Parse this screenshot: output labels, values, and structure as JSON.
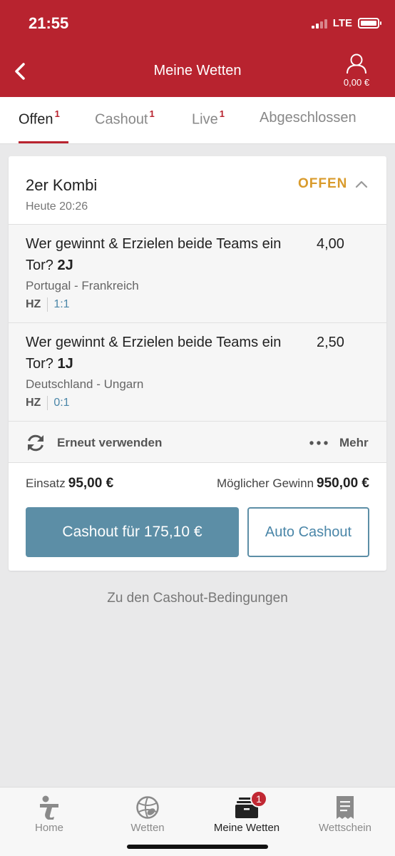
{
  "status_bar": {
    "time": "21:55",
    "network": "LTE"
  },
  "header": {
    "title": "Meine Wetten",
    "balance": "0,00 €"
  },
  "tabs": [
    {
      "label": "Offen",
      "count": "1",
      "active": true
    },
    {
      "label": "Cashout",
      "count": "1"
    },
    {
      "label": "Live",
      "count": "1"
    },
    {
      "label": "Abgeschlossen",
      "count": ""
    }
  ],
  "bet": {
    "type": "2er Kombi",
    "date": "Heute 20:26",
    "status": "OFFEN",
    "selections": [
      {
        "market": "Wer gewinnt & Erzielen beide Teams ein Tor?",
        "pick": "2J",
        "odds": "4,00",
        "event": "Portugal - Frankreich",
        "score_label": "HZ",
        "score": "1:1"
      },
      {
        "market": "Wer gewinnt & Erzielen beide Teams ein Tor?",
        "pick": "1J",
        "odds": "2,50",
        "event": "Deutschland - Ungarn",
        "score_label": "HZ",
        "score": "0:1"
      }
    ],
    "reuse_label": "Erneut verwenden",
    "more_label": "Mehr",
    "stake_label": "Einsatz",
    "stake": "95,00 €",
    "win_label": "Möglicher Gewinn",
    "win": "950,00 €",
    "cashout_button": "Cashout für 175,10 €",
    "auto_cashout_button": "Auto Cashout"
  },
  "conditions_link": "Zu den Cashout-Bedingungen",
  "bottom_nav": [
    {
      "label": "Home",
      "icon": "home-logo-icon"
    },
    {
      "label": "Wetten",
      "icon": "sports-balls-icon"
    },
    {
      "label": "Meine Wetten",
      "icon": "bet-slips-icon",
      "badge": "1",
      "active": true
    },
    {
      "label": "Wettschein",
      "icon": "receipt-icon"
    }
  ],
  "colors": {
    "brand": "#b8232f",
    "accent": "#5c8ea6",
    "status_open": "#d99b2c"
  }
}
